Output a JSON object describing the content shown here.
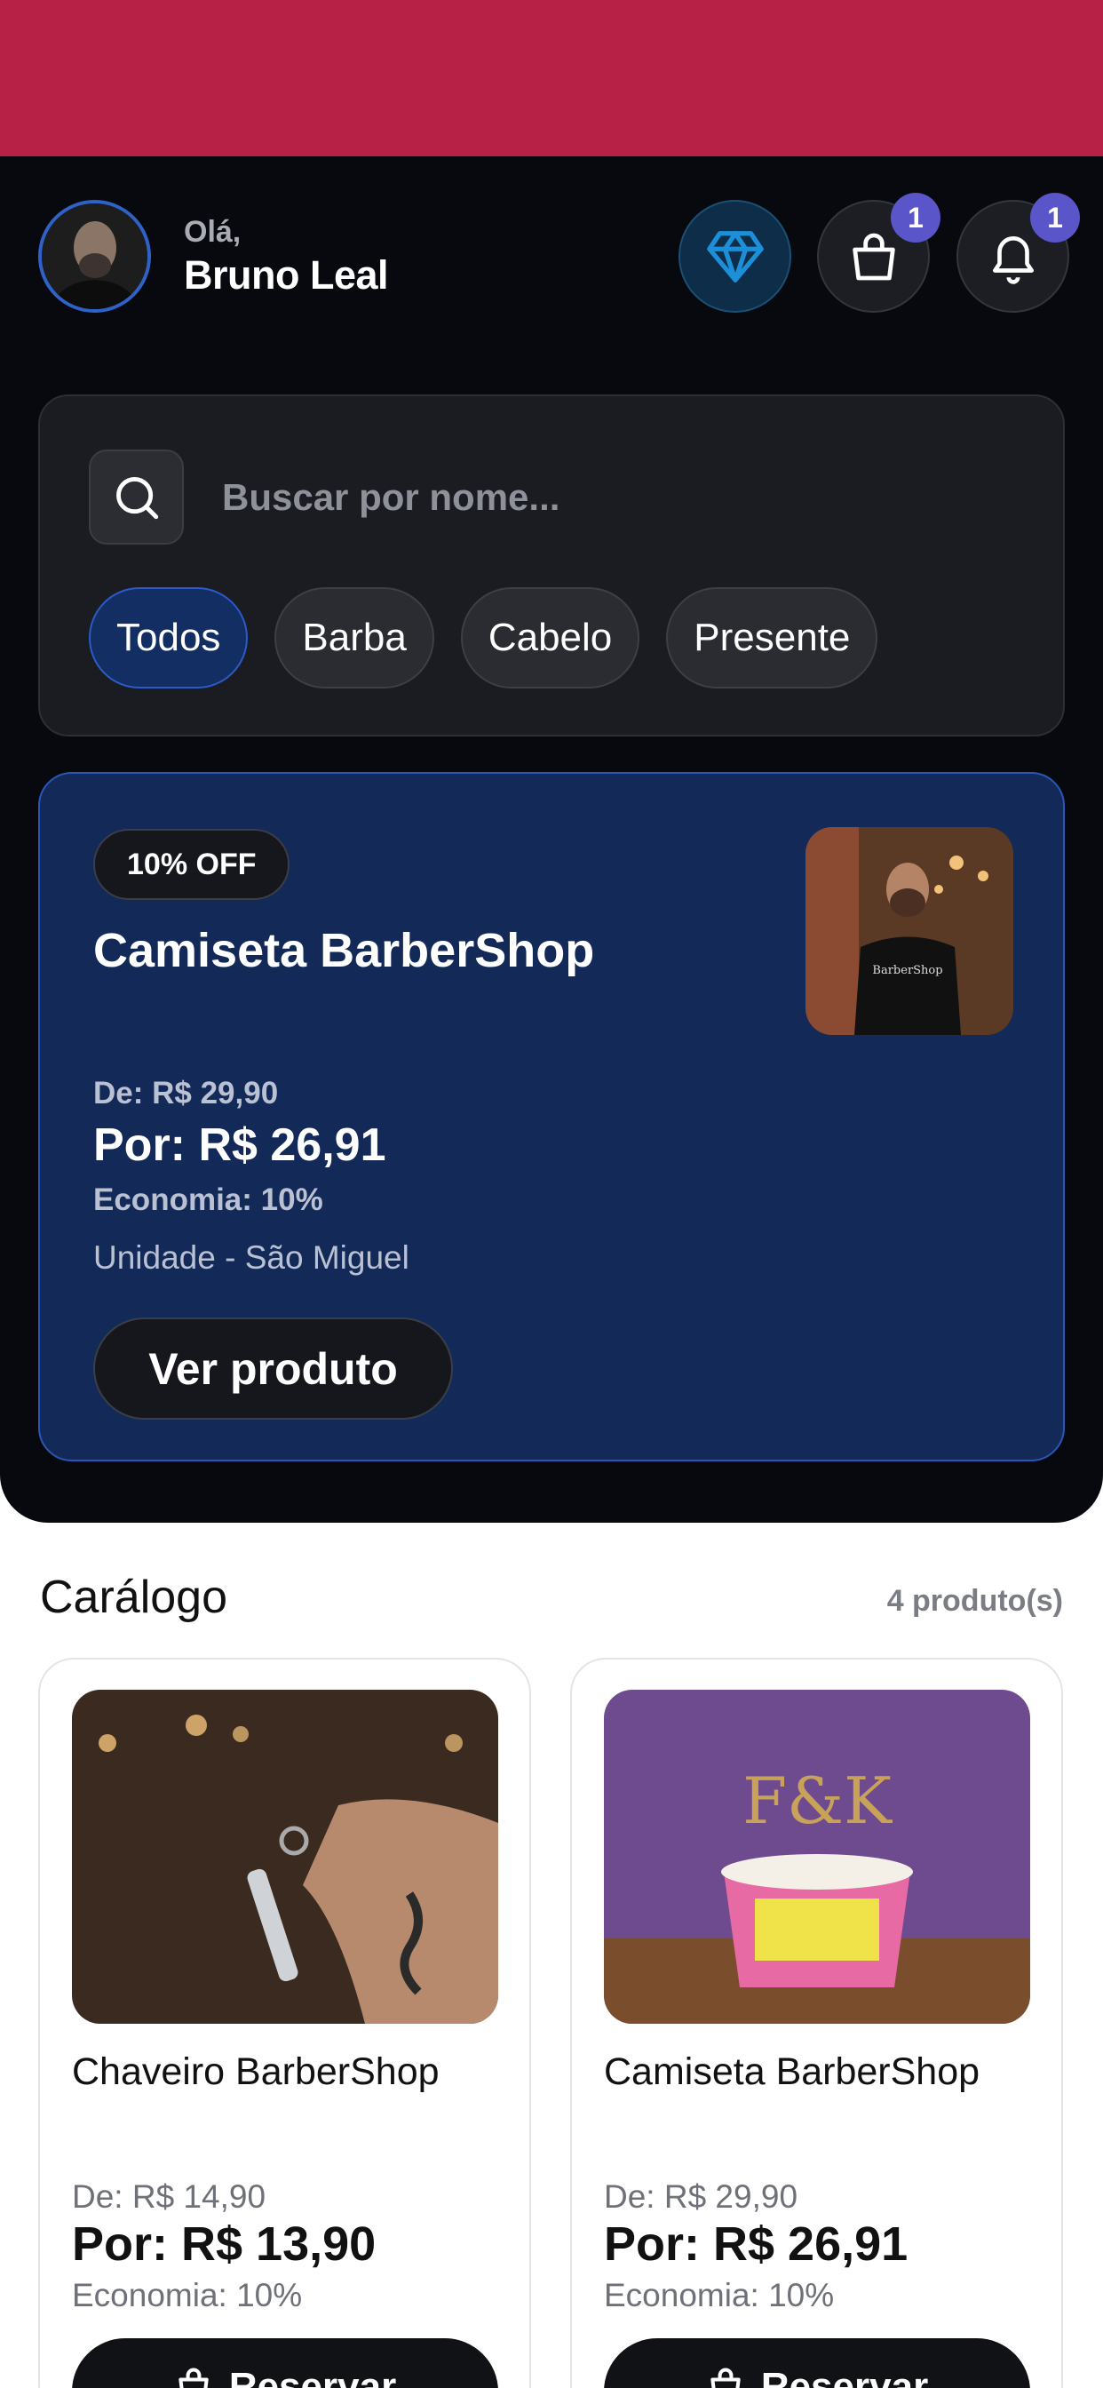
{
  "header": {
    "greeting": "Olá,",
    "user_name": "Bruno Leal",
    "bag_badge": "1",
    "notifications_badge": "1"
  },
  "search": {
    "placeholder": "Buscar por nome...",
    "value": ""
  },
  "filters": [
    {
      "label": "Todos",
      "active": true
    },
    {
      "label": "Barba",
      "active": false
    },
    {
      "label": "Cabelo",
      "active": false
    },
    {
      "label": "Presente",
      "active": false
    }
  ],
  "promo": {
    "badge": "10% OFF",
    "title": "Camiseta BarberShop",
    "de": "De: R$ 29,90",
    "por": "Por: R$ 26,91",
    "economia": "Economia: 10%",
    "unidade": "Unidade - São Miguel",
    "button": "Ver produto"
  },
  "catalog": {
    "title": "Carálogo",
    "count": "4 produto(s)",
    "products": [
      {
        "name": "Chaveiro BarberShop",
        "de": "De: R$ 14,90",
        "por": "Por: R$ 13,90",
        "economia": "Economia: 10%",
        "button": "Reservar"
      },
      {
        "name": "Camiseta BarberShop",
        "de": "De: R$ 29,90",
        "por": "Por: R$ 26,91",
        "economia": "Economia: 10%",
        "button": "Reservar"
      }
    ]
  },
  "colors": {
    "status_bar": "#b82146",
    "accent": "#2b5bc8",
    "badge": "#5a55c8"
  }
}
